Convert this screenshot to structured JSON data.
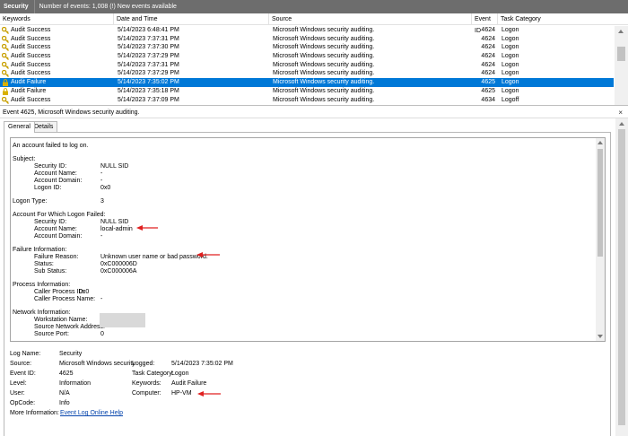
{
  "titlebar": {
    "log_name": "Security",
    "summary": "Number of events: 1,008 (!) New events available"
  },
  "columns": {
    "keywords": "Keywords",
    "datetime": "Date and Time",
    "source": "Source",
    "event_id": "Event ID",
    "task": "Task Category"
  },
  "events": [
    {
      "keywords": "Audit Success",
      "datetime": "5/14/2023 6:48:41 PM",
      "source": "Microsoft Windows security auditing.",
      "event_id": "4624",
      "task": "Logon",
      "icon": "key-icon"
    },
    {
      "keywords": "Audit Success",
      "datetime": "5/14/2023 7:37:31 PM",
      "source": "Microsoft Windows security auditing.",
      "event_id": "4624",
      "task": "Logon",
      "icon": "key-icon"
    },
    {
      "keywords": "Audit Success",
      "datetime": "5/14/2023 7:37:30 PM",
      "source": "Microsoft Windows security auditing.",
      "event_id": "4624",
      "task": "Logon",
      "icon": "key-icon"
    },
    {
      "keywords": "Audit Success",
      "datetime": "5/14/2023 7:37:29 PM",
      "source": "Microsoft Windows security auditing.",
      "event_id": "4624",
      "task": "Logon",
      "icon": "key-icon"
    },
    {
      "keywords": "Audit Success",
      "datetime": "5/14/2023 7:37:31 PM",
      "source": "Microsoft Windows security auditing.",
      "event_id": "4624",
      "task": "Logon",
      "icon": "key-icon"
    },
    {
      "keywords": "Audit Success",
      "datetime": "5/14/2023 7:37:29 PM",
      "source": "Microsoft Windows security auditing.",
      "event_id": "4624",
      "task": "Logon",
      "icon": "key-icon"
    },
    {
      "keywords": "Audit Failure",
      "datetime": "5/14/2023 7:35:02 PM",
      "source": "Microsoft Windows security auditing.",
      "event_id": "4625",
      "task": "Logon",
      "icon": "lock-icon",
      "selected": true
    },
    {
      "keywords": "Audit Failure",
      "datetime": "5/14/2023 7:35:18 PM",
      "source": "Microsoft Windows security auditing.",
      "event_id": "4625",
      "task": "Logon",
      "icon": "lock-icon"
    },
    {
      "keywords": "Audit Success",
      "datetime": "5/14/2023 7:37:09 PM",
      "source": "Microsoft Windows security auditing.",
      "event_id": "4634",
      "task": "Logoff",
      "icon": "key-icon"
    }
  ],
  "detail": {
    "header": "Event 4625, Microsoft Windows security auditing.",
    "close_glyph": "×",
    "tabs": [
      "General",
      "Details"
    ],
    "description": [
      {
        "label": "An account failed to log on.",
        "indent": 0
      },
      {
        "label": "Subject:",
        "indent": 0
      },
      {
        "label": "Security ID:",
        "value": "NULL SID",
        "indent": 1
      },
      {
        "label": "Account Name:",
        "value": "-",
        "indent": 1
      },
      {
        "label": "Account Domain:",
        "value": "-",
        "indent": 1
      },
      {
        "label": "Logon ID:",
        "value": "0x0",
        "indent": 1
      },
      {
        "label": "Logon Type:",
        "value": "3",
        "indent": 0
      },
      {
        "label": "Account For Which Logon Failed:",
        "indent": 0
      },
      {
        "label": "Security ID:",
        "value": "NULL SID",
        "indent": 1
      },
      {
        "label": "Account Name:",
        "value": "local-admin",
        "indent": 1
      },
      {
        "label": "Account Domain:",
        "value": "-",
        "indent": 1
      },
      {
        "label": "Failure Information:",
        "indent": 0
      },
      {
        "label": "Failure Reason:",
        "value": "Unknown user name or bad password.",
        "indent": 1
      },
      {
        "label": "Status:",
        "value": "0xC000006D",
        "indent": 1
      },
      {
        "label": "Sub Status:",
        "value": "0xC000006A",
        "indent": 1
      },
      {
        "label": "Process Information:",
        "indent": 0
      },
      {
        "label": "Caller Process ID:",
        "value": "0x0",
        "indent": 1
      },
      {
        "label": "Caller Process Name:",
        "value": "-",
        "indent": 1
      },
      {
        "label": "Network Information:",
        "indent": 0
      },
      {
        "label": "Workstation Name:",
        "value": "",
        "indent": 1
      },
      {
        "label": "Source Network Address:",
        "value": "",
        "indent": 1
      },
      {
        "label": "Source Port:",
        "value": "0",
        "indent": 1
      }
    ],
    "properties": {
      "log_name_label": "Log Name:",
      "log_name": "Security",
      "source_label": "Source:",
      "source": "Microsoft Windows security",
      "logged_label": "Logged:",
      "logged": "5/14/2023 7:35:02 PM",
      "event_id_label": "Event ID:",
      "event_id": "4625",
      "task_label": "Task Category:",
      "task": "Logon",
      "level_label": "Level:",
      "level": "Information",
      "keywords_label": "Keywords:",
      "keywords": "Audit Failure",
      "user_label": "User:",
      "user": "N/A",
      "computer_label": "Computer:",
      "computer": "HP-VM",
      "opcode_label": "OpCode:",
      "opcode": "Info",
      "more_info_label": "More Information:",
      "more_info_link": "Event Log Online Help"
    }
  },
  "colors": {
    "titlebar": "#6d6d6d",
    "selection": "#0078d7",
    "annotation_arrow": "#e02020",
    "link": "#0645ad"
  }
}
